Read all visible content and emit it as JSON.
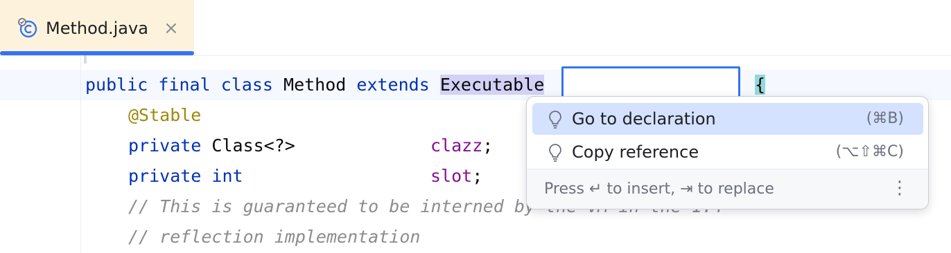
{
  "tab": {
    "title": "Method.java",
    "close": "×",
    "icon": "class-icon"
  },
  "code": {
    "line1": {
      "kw1": "public",
      "kw2": "final",
      "kw3": "class",
      "name": "Method",
      "kw4": "extends",
      "target": "Executable",
      "brace": "{"
    },
    "line2": {
      "annotation": "@Stable"
    },
    "line3": {
      "kw": "private",
      "type": "Class<?>",
      "field": "clazz",
      "semi": ";"
    },
    "line4": {
      "kw": "private",
      "type": "int",
      "field": "slot",
      "semi": ";"
    },
    "line5": {
      "comment": "// This is guaranteed to be interned by the VM in the 1.4"
    },
    "line6": {
      "comment": "// reflection implementation"
    }
  },
  "popup": {
    "items": [
      {
        "label": "Go to declaration",
        "shortcut": "(⌘B)",
        "icon": "lightbulb-icon",
        "selected": true
      },
      {
        "label": "Copy reference",
        "shortcut": "(⌥⇧⌘C)",
        "icon": "lightbulb-icon",
        "selected": false
      }
    ],
    "hint": "Press ↵ to insert, ⇥ to replace",
    "more": "⋮"
  },
  "colors": {
    "accent": "#3574f0",
    "tab_bg": "#fdf3dc",
    "selection": "#d4e2ff"
  }
}
